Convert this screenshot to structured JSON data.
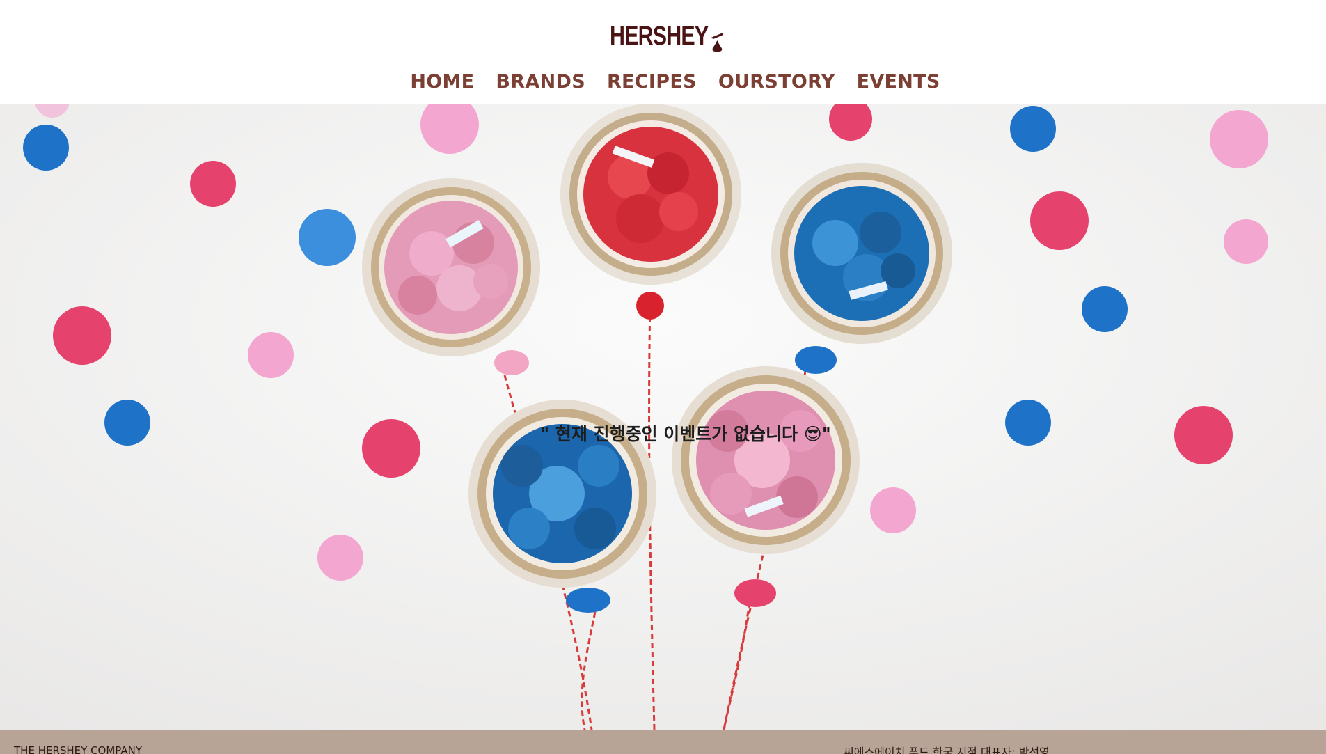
{
  "brand": {
    "logo_text": "HERSHEY"
  },
  "nav": {
    "items": [
      {
        "label": "HOME"
      },
      {
        "label": "BRANDS"
      },
      {
        "label": "RECIPES"
      },
      {
        "label": "OURSTORY"
      },
      {
        "label": "EVENTS"
      }
    ]
  },
  "hero": {
    "event_message": "\" 현재 진행중인 이벤트가 없습니다 😎\""
  },
  "footer": {
    "company": "THE HERSHEY COMPANY",
    "korea_info": "씨에스에이치 푸드 한국 지점 대표자: 박선영"
  },
  "colors": {
    "nav_text": "#7b3f33",
    "logo": "#4a1414",
    "footer_bg": "#b8a497",
    "confetti_blue": "#1e73c8",
    "confetti_red": "#e5426e",
    "confetti_pink": "#f3a6d0"
  }
}
